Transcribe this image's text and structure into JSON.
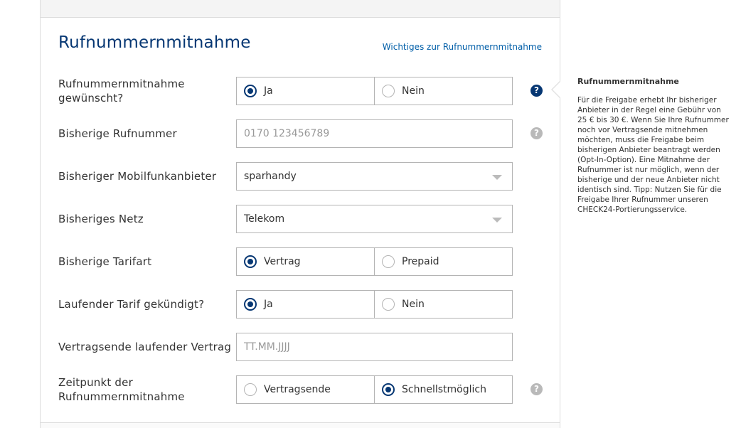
{
  "section": {
    "title": "Rufnummernmitnahme",
    "info_link": "Wichtiges zur Rufnummernmitnahme"
  },
  "fields": {
    "wanted": {
      "label": "Rufnummernmitnahme gewünscht?",
      "options": [
        "Ja",
        "Nein"
      ],
      "selected": "Ja"
    },
    "number": {
      "label": "Bisherige Rufnummer",
      "placeholder": "0170 123456789"
    },
    "provider": {
      "label": "Bisheriger Mobilfunkanbieter",
      "value": "sparhandy"
    },
    "network": {
      "label": "Bisheriges Netz",
      "value": "Telekom"
    },
    "tariff_type": {
      "label": "Bisherige Tarifart",
      "options": [
        "Vertrag",
        "Prepaid"
      ],
      "selected": "Vertrag"
    },
    "cancelled": {
      "label": "Laufender Tarif gekündigt?",
      "options": [
        "Ja",
        "Nein"
      ],
      "selected": "Ja"
    },
    "contract_end": {
      "label": "Vertragsende laufender Vertrag",
      "placeholder": "TT.MM.JJJJ"
    },
    "timing": {
      "label": "Zeitpunkt der Rufnummernmitnahme",
      "options": [
        "Vertragsende",
        "Schnellstmöglich"
      ],
      "selected": "Schnellstmöglich"
    }
  },
  "help_icon": "?",
  "tooltip": {
    "title": "Rufnummernmitnahme",
    "text": "Für die Freigabe erhebt Ihr bisheriger Anbieter in der Regel eine Gebühr von 25 € bis 30 €. Wenn Sie Ihre Rufnummer noch vor Vertragsende mitnehmen möchten, muss die Freigabe beim bisherigen Anbieter beantragt werden (Opt-In-Option). Eine Mitnahme der Rufnummer ist nur möglich, wenn der bisherige und der neue Anbieter nicht identisch sind. Tipp: Nutzen Sie für die Freigabe Ihrer Rufnummer unseren CHECK24-Portierungsservice."
  },
  "colors": {
    "primary": "#063773",
    "link": "#005ea8",
    "border": "#b4b4b4",
    "help_inactive": "#b9b9b9"
  }
}
